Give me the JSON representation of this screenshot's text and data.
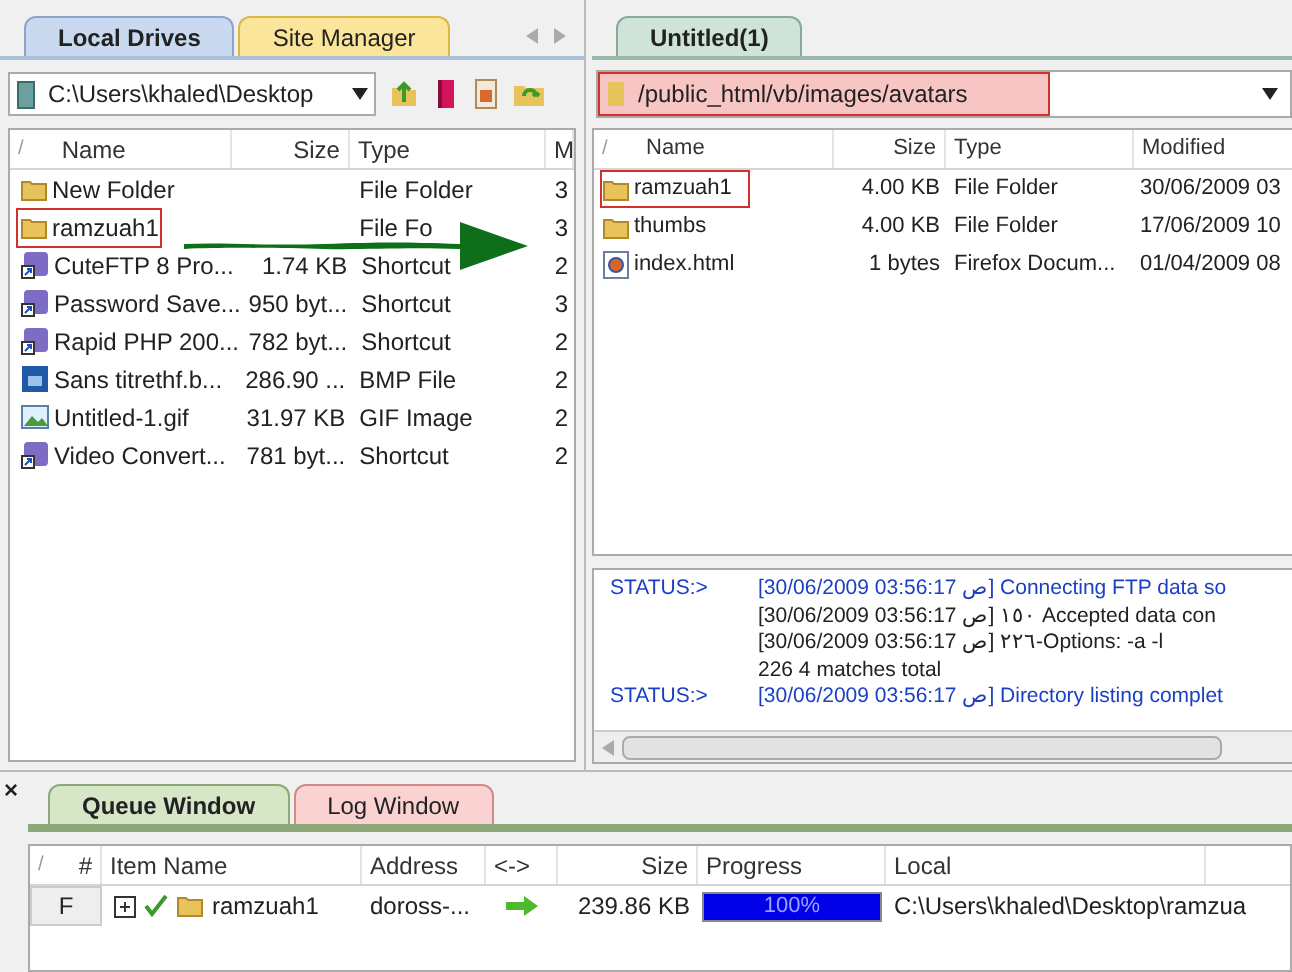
{
  "left_pane": {
    "tabs": [
      {
        "label": "Local Drives",
        "selected": true
      },
      {
        "label": "Site Manager",
        "selected": false
      }
    ],
    "path": "C:\\Users\\khaled\\Desktop",
    "columns": [
      "/",
      "Name",
      "Size",
      "Type",
      "M"
    ],
    "rows": [
      {
        "kind": "folder",
        "name": "New Folder",
        "type": "File Folder",
        "column_4": "3",
        "highlighted": false
      },
      {
        "kind": "folder",
        "name": "ramzuah1",
        "type": "File Fo",
        "column_4": "3",
        "highlighted": true
      },
      {
        "kind": "shortcut",
        "name": "CuteFTP 8 Pro...",
        "size": "1.74 KB",
        "type": "Shortcut",
        "column_4": "2",
        "highlighted": false
      },
      {
        "kind": "shortcut",
        "name": "Password Save...",
        "size": "950 byt...",
        "type": "Shortcut",
        "column_4": "3",
        "highlighted": false
      },
      {
        "kind": "shortcut",
        "name": "Rapid PHP 200...",
        "size": "782 byt...",
        "type": "Shortcut",
        "column_4": "2",
        "highlighted": false
      },
      {
        "kind": "psd",
        "name": "Sans titrethf.b...",
        "size": "286.90 ...",
        "type": "BMP File",
        "column_4": "2",
        "highlighted": false
      },
      {
        "kind": "image",
        "name": "Untitled-1.gif",
        "size": "31.97 KB",
        "type": "GIF Image",
        "column_4": "2",
        "highlighted": false
      },
      {
        "kind": "shortcut",
        "name": "Video Convert...",
        "size": "781 byt...",
        "type": "Shortcut",
        "column_4": "2",
        "highlighted": false
      }
    ]
  },
  "right_pane": {
    "tabs": [
      {
        "label": "Untitled(1)",
        "selected": true
      }
    ],
    "path": "/public_html/vb/images/avatars",
    "path_highlighted": true,
    "columns": [
      "/",
      "Name",
      "Size",
      "Type",
      "Modified"
    ],
    "rows": [
      {
        "kind": "folder",
        "name": "ramzuah1",
        "size": "4.00 KB",
        "type": "File Folder",
        "modified": "30/06/2009 03",
        "highlighted": true
      },
      {
        "kind": "folder",
        "name": "thumbs",
        "size": "4.00 KB",
        "type": "File Folder",
        "modified": "17/06/2009 10",
        "highlighted": false
      },
      {
        "kind": "html",
        "name": "index.html",
        "size": "1 bytes",
        "type": "Firefox Docum...",
        "modified": "01/04/2009 08",
        "highlighted": false
      }
    ]
  },
  "log": [
    {
      "label": "STATUS:>",
      "text": "[30/06/2009 03:56:17 ص] Connecting FTP data so"
    },
    {
      "text": "[30/06/2009 03:56:17 ص] ١٥٠ Accepted data con"
    },
    {
      "text": "[30/06/2009 03:56:17 ص] ٢٢٦-Options: -a -l"
    },
    {
      "text": "226 4 matches total"
    },
    {
      "label": "STATUS:>",
      "text": "[30/06/2009 03:56:17 ص] Directory listing complet"
    }
  ],
  "queue": {
    "close": "×",
    "tabs": [
      {
        "label": "Queue Window",
        "selected": true
      },
      {
        "label": "Log Window",
        "selected": false
      }
    ],
    "columns": [
      "/",
      "#",
      "Item Name",
      "Address",
      "<->",
      "Size",
      "Progress",
      "Local"
    ],
    "rows": [
      {
        "number": "F",
        "name": "ramzuah1",
        "address": "doross-...",
        "size": "239.86 KB",
        "level": 1,
        "progress": "100%",
        "local": "C:\\Users\\khaled\\Desktop\\ramzua"
      }
    ]
  }
}
